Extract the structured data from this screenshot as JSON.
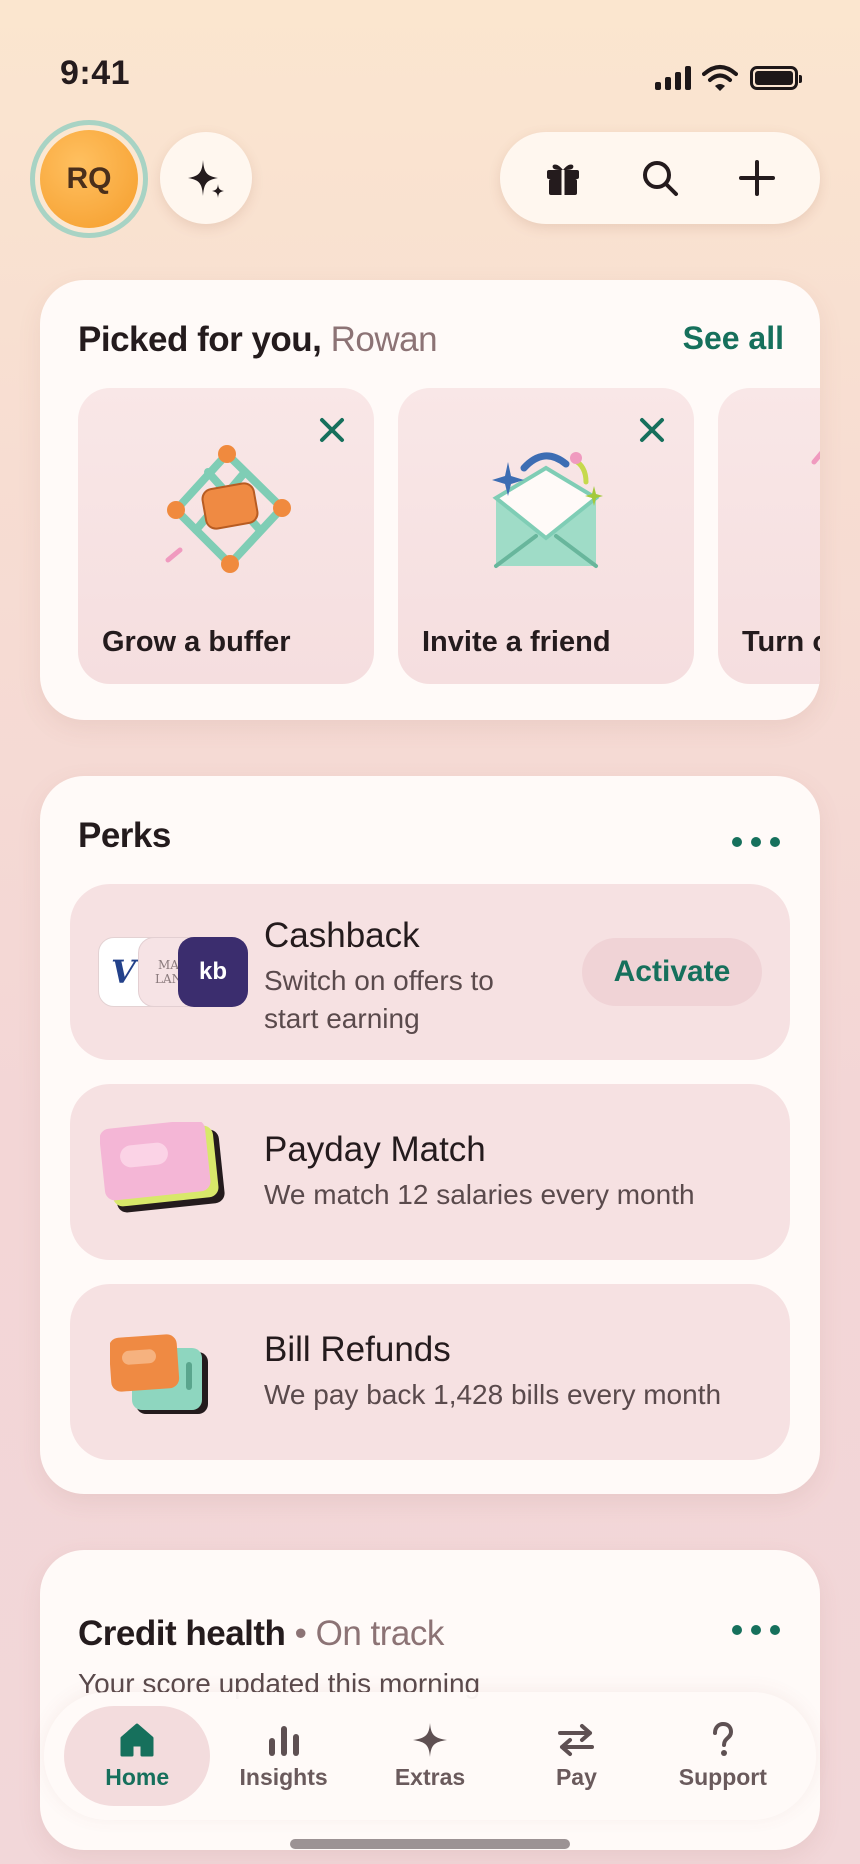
{
  "status": {
    "time": "9:41"
  },
  "header": {
    "avatar_initials": "RQ",
    "icons": [
      "sparkle-icon",
      "gift-icon",
      "search-icon",
      "plus-icon"
    ]
  },
  "picked": {
    "title": "Picked for you,",
    "name": "Rowan",
    "see_all": "See all",
    "tiles": [
      {
        "label": "Grow a buffer"
      },
      {
        "label": "Invite a friend"
      },
      {
        "label": "Turn on cashback"
      }
    ]
  },
  "perks": {
    "title": "Perks",
    "items": [
      {
        "title": "Cashback",
        "description": "Switch on offers to start earning",
        "action": "Activate",
        "logos": [
          "V",
          "MAR LANE",
          "kb"
        ]
      },
      {
        "title": "Payday Match",
        "description": "We match 12 salaries every month"
      },
      {
        "title": "Bill Refunds",
        "description": "We pay back 1,428 bills every month"
      }
    ]
  },
  "credit": {
    "title": "Credit health",
    "status": "• On track",
    "subtitle": "Your score updated this morning"
  },
  "tabs": [
    {
      "label": "Home",
      "active": true
    },
    {
      "label": "Insights"
    },
    {
      "label": "Extras"
    },
    {
      "label": "Pay"
    },
    {
      "label": "Support"
    }
  ],
  "colors": {
    "accent": "#16705c",
    "background": "#f3d6d6",
    "card": "#fffaf8"
  }
}
